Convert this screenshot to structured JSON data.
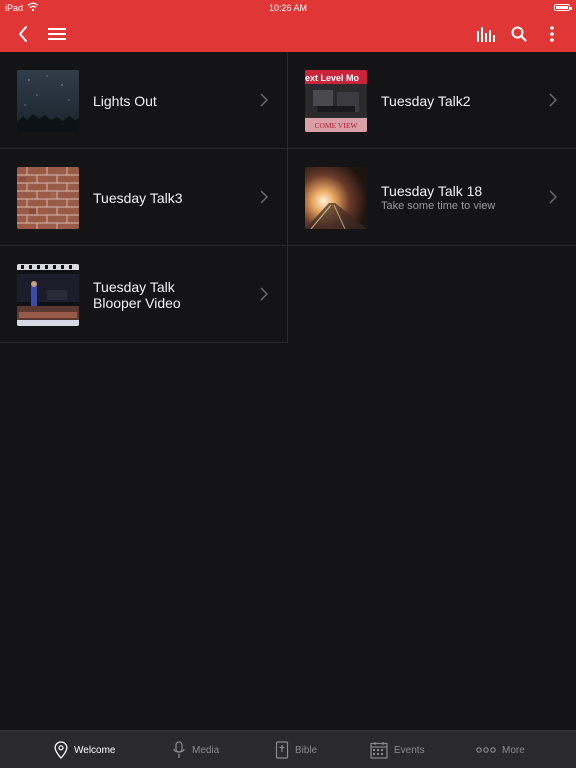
{
  "status_bar": {
    "carrier": "iPad",
    "time": "10:26 AM"
  },
  "app_bar": {
    "background": "#e03636",
    "icons": [
      "back-icon",
      "hamburger-menu-icon",
      "equalizer-icon",
      "search-icon",
      "more-vertical-icon"
    ]
  },
  "items": [
    {
      "title": "Lights Out",
      "subtitle": "",
      "thumb": "night-sky"
    },
    {
      "title": "Tuesday Talk2",
      "subtitle": "",
      "thumb": "next-level-poster",
      "thumb_text_top": "ext Level Mo",
      "thumb_text_bottom": "COME VIEW"
    },
    {
      "title": "Tuesday Talk3",
      "subtitle": "",
      "thumb": "brick-wall"
    },
    {
      "title": "Tuesday Talk 18",
      "subtitle": "Take some time to view",
      "thumb": "road-lights"
    },
    {
      "title": "Tuesday Talk Blooper Video",
      "title_line1": "Tuesday Talk",
      "title_line2": "Blooper Video",
      "subtitle": "",
      "thumb": "stage-performance"
    }
  ],
  "tabs": [
    {
      "label": "Welcome",
      "icon": "location-pin-icon",
      "active": true
    },
    {
      "label": "Media",
      "icon": "microphone-icon",
      "active": false
    },
    {
      "label": "Bible",
      "icon": "bible-icon",
      "active": false
    },
    {
      "label": "Events",
      "icon": "calendar-icon",
      "active": false
    },
    {
      "label": "More",
      "icon": "more-dots-icon",
      "active": false
    }
  ]
}
